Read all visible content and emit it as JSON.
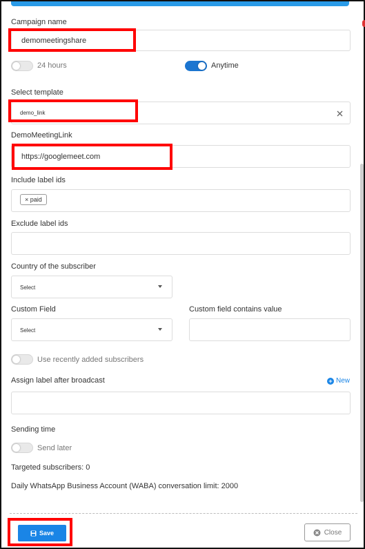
{
  "form": {
    "campaign_name_label": "Campaign name",
    "campaign_name_value": "demomeetingshare",
    "toggle_24h_label": "24 hours",
    "toggle_anytime_label": "Anytime",
    "select_template_label": "Select template",
    "select_template_value": "demo_link",
    "demo_meeting_link_label": "DemoMeetingLink",
    "demo_meeting_link_value": "https://googlemeet.com",
    "include_label_ids_label": "Include label ids",
    "include_tag_text": "paid",
    "include_tag_remove": "×",
    "exclude_label_ids_label": "Exclude label ids",
    "country_label": "Country of the subscriber",
    "country_value": "Select",
    "custom_field_label": "Custom Field",
    "custom_field_value": "Select",
    "custom_field_contains_label": "Custom field contains value",
    "recently_added_label": "Use recently added subscribers",
    "assign_label_after_broadcast_label": "Assign label after broadcast",
    "new_label": "New",
    "sending_time_label": "Sending time",
    "send_later_label": "Send later",
    "targeted_subscribers": "Targeted subscribers: 0",
    "daily_limit": "Daily WhatsApp Business Account (WABA) conversation limit: 2000"
  },
  "footer": {
    "save_label": "Save",
    "close_label": "Close"
  },
  "colors": {
    "accent": "#1a85e6",
    "highlight_box": "#ff0000",
    "topbar": "#2a9be8"
  },
  "icons": [
    "save-icon",
    "close-circle-icon",
    "clear-x-icon",
    "plus-circle-icon",
    "chevron-down-icon"
  ]
}
